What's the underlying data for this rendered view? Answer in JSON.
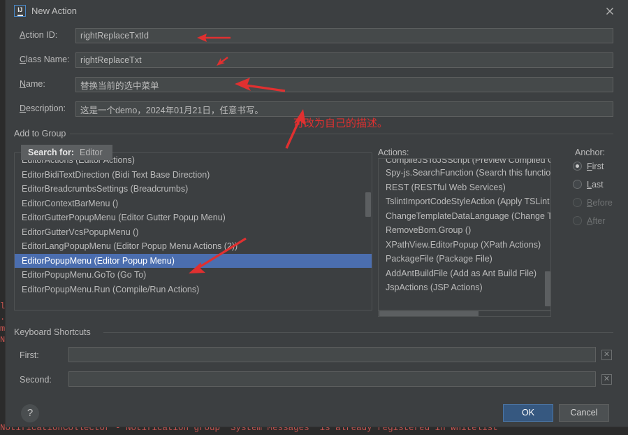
{
  "window": {
    "title": "New Action",
    "app_icon": "intellij-idea-icon",
    "close_icon": "close-icon"
  },
  "form": {
    "fields": [
      {
        "label": "Action ID:",
        "mnemonic": "A",
        "rest": "ction ID:",
        "value": "rightReplaceTxtId",
        "name": "action-id"
      },
      {
        "label": "Class Name:",
        "mnemonic": "C",
        "rest": "lass Name:",
        "value": "rightReplaceTxt",
        "name": "class-name"
      },
      {
        "label": "Name:",
        "mnemonic": "N",
        "rest": "ame:",
        "value": "替换当前的选中菜单",
        "name": "name"
      },
      {
        "label": "Description:",
        "mnemonic": "D",
        "rest": "escription:",
        "value": "这是一个demo，2024年01月21日，任意书写。",
        "name": "description"
      }
    ]
  },
  "add_to_group": {
    "title": "Add to Group",
    "search_popup": {
      "label": "Search for:",
      "value": "Editor"
    },
    "groups": [
      "EditorActions (Editor Actions)",
      "EditorBidiTextDirection (Bidi Text Base Direction)",
      "EditorBreadcrumbsSettings (Breadcrumbs)",
      "EditorContextBarMenu ()",
      "EditorGutterPopupMenu (Editor Gutter Popup Menu)",
      "EditorGutterVcsPopupMenu ()",
      "EditorLangPopupMenu (Editor Popup Menu Actions (2))",
      "EditorPopupMenu (Editor Popup Menu)",
      "EditorPopupMenu.GoTo (Go To)",
      "EditorPopupMenu.Run (Compile/Run Actions)"
    ],
    "selected_group": "EditorPopupMenu (Editor Popup Menu)",
    "selected_index": 7
  },
  "actions_panel": {
    "title": "Actions:",
    "clipped_top_item": "CompileJSToJSScript (Preview Compiled Co",
    "items": [
      "Spy-js.SearchFunction (Search this function",
      "REST (RESTful Web Services)",
      "TslintImportCodeStyleAction (Apply TSLint",
      "ChangeTemplateDataLanguage (Change Te",
      "RemoveBom.Group ()",
      "XPathView.EditorPopup (XPath Actions)",
      "PackageFile (Package File)",
      "AddAntBuildFile (Add as Ant Build File)",
      "JspActions (JSP Actions)"
    ]
  },
  "anchor": {
    "title": "Anchor:",
    "options": [
      {
        "label": "First",
        "mnemonic": "F",
        "rest": "irst",
        "checked": true,
        "disabled": false
      },
      {
        "label": "Last",
        "mnemonic": "L",
        "rest": "ast",
        "checked": false,
        "disabled": false
      },
      {
        "label": "Before",
        "mnemonic": "B",
        "rest": "efore",
        "checked": false,
        "disabled": true
      },
      {
        "label": "After",
        "mnemonic": "A",
        "rest": "fter",
        "checked": false,
        "disabled": true
      }
    ]
  },
  "keyboard_shortcuts": {
    "title": "Keyboard Shortcuts",
    "first": {
      "label": "First:",
      "value": "",
      "clear_icon": "clear-x-icon"
    },
    "second": {
      "label": "Second:",
      "value": "",
      "clear_icon": "clear-x-icon"
    }
  },
  "buttons": {
    "help": "?",
    "ok": "OK",
    "cancel": "Cancel"
  },
  "annotations": {
    "description_note": "可改为自己的描述。",
    "arrow_color": "#e03030"
  },
  "ide_background": {
    "log_line": "NotificationCollector - Notification group 'System Messages' is already registered in whitelist",
    "left_fragment": "l\n.\nm\nN",
    "right_fragment": ";\n:",
    "log_color": "#c75450"
  }
}
